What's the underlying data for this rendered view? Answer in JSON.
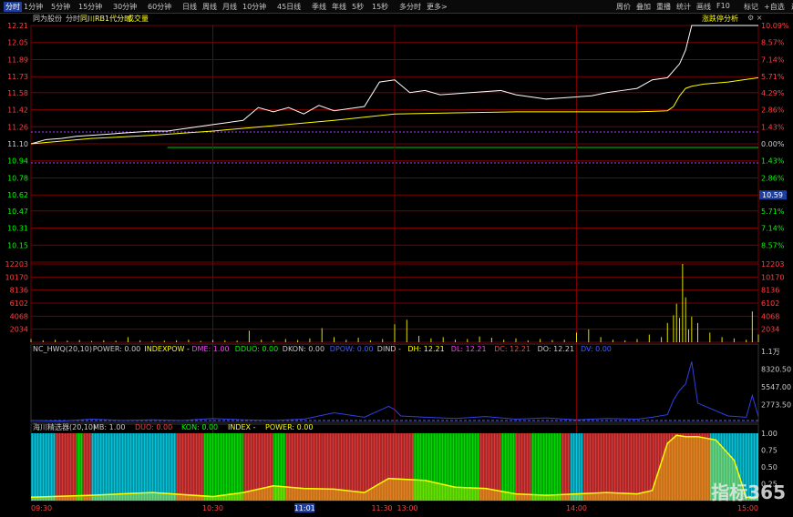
{
  "toolbar": {
    "periods": [
      "分时",
      "1分钟",
      "5分钟",
      "15分钟",
      "30分钟",
      "60分钟",
      "日线",
      "周线",
      "月线",
      "10分钟",
      "45日线",
      "季线",
      "年线",
      "5秒",
      "15秒",
      "多分时",
      "更多>"
    ],
    "right": [
      "周价",
      "叠加",
      "重播",
      "统计",
      "画线",
      "F10",
      "标记",
      "+自选",
      "返回"
    ]
  },
  "info": {
    "label1": "同为股份",
    "label2": "分时",
    "label3": "同川RB1代分时",
    "label4": "成交量",
    "right_label": "涨跌停分析"
  },
  "main_axis": {
    "left": [
      "12.21",
      "12.05",
      "11.89",
      "11.73",
      "11.58",
      "11.42",
      "11.26",
      "11.10",
      "10.94",
      "10.78",
      "10.62",
      "10.47",
      "10.31",
      "10.15"
    ],
    "right": [
      "10.09%",
      "8.57%",
      "7.14%",
      "5.71%",
      "4.29%",
      "2.86%",
      "1.43%",
      "0.00%",
      "1.43%",
      "2.86%",
      "4.29%",
      "5.71%",
      "7.14%",
      "8.57%"
    ],
    "current_price": "10.59"
  },
  "volume_axis": {
    "labels": [
      "12203",
      "10170",
      "8136",
      "6102",
      "4068",
      "2034"
    ]
  },
  "ind1": {
    "name": "NC_HWQ(20,10)",
    "power": "POWER: 0.00",
    "indexpow": "INDEXPOW -",
    "dme": "DME: 1.00",
    "dduo": "DDUO: 0.00",
    "dkon": "DKON: 0.00",
    "dpow": "DPOW: 0.00",
    "dind": "DIND -",
    "dh": "DH: 12.21",
    "dl": "DL: 12.21",
    "dc": "DC: 12.21",
    "do": "DO: 12.21",
    "dv": "DV: 0.00",
    "axis": [
      "1.1万",
      "8320.50",
      "5547.00",
      "2773.50"
    ]
  },
  "ind2": {
    "name": "海川精选器(20,10)",
    "mb": "MB: 1.00",
    "duo": "DUO: 0.00",
    "kon": "KON: 0.00",
    "index": "INDEX -",
    "power": "POWER: 0.00",
    "axis": [
      "1.00",
      "0.75",
      "0.50",
      "0.25"
    ]
  },
  "time_axis": [
    "09:30",
    "10:30",
    "11:30",
    "13:00",
    "14:00",
    "15:00"
  ],
  "cursor_time": "11:01",
  "watermark": "指标365",
  "colors": {
    "price": "#ffffff",
    "avg": "#ffff00",
    "grid": "#8b0000",
    "up": "#ff4040",
    "down": "#00ff00",
    "cyan": "#00e5ff"
  },
  "chart_data": [
    {
      "type": "line",
      "title": "",
      "ylim": [
        9.99,
        12.21
      ],
      "prev_close": 11.1,
      "x_range": [
        0,
        240
      ],
      "series": [
        {
          "x": [
            0,
            5,
            10,
            15,
            20,
            25,
            30,
            35,
            40,
            45,
            50,
            55,
            60,
            65,
            70,
            75,
            80,
            85,
            90,
            95,
            100,
            105,
            110,
            115,
            120,
            125,
            130,
            135,
            140,
            145,
            150,
            155,
            160,
            165,
            170,
            175,
            180,
            185,
            190,
            195,
            200,
            205,
            210,
            214,
            216,
            218,
            222,
            226,
            230,
            235,
            240
          ],
          "values": [
            11.1,
            11.14,
            11.15,
            11.17,
            11.18,
            11.19,
            11.2,
            11.21,
            11.22,
            11.22,
            11.24,
            11.26,
            11.28,
            11.3,
            11.32,
            11.44,
            11.4,
            11.44,
            11.38,
            11.46,
            11.41,
            11.43,
            11.45,
            11.68,
            11.7,
            11.58,
            11.6,
            11.56,
            11.57,
            11.58,
            11.59,
            11.6,
            11.56,
            11.54,
            11.52,
            11.53,
            11.54,
            11.55,
            11.58,
            11.6,
            11.62,
            11.7,
            11.72,
            11.85,
            11.98,
            12.21,
            12.21,
            12.21,
            12.21,
            12.21,
            12.21
          ]
        },
        {
          "x": [
            0,
            20,
            40,
            60,
            80,
            100,
            120,
            140,
            160,
            180,
            200,
            210,
            212,
            214,
            216,
            218,
            222,
            230,
            240
          ],
          "values": [
            11.1,
            11.15,
            11.18,
            11.22,
            11.27,
            11.32,
            11.38,
            11.39,
            11.4,
            11.4,
            11.4,
            11.41,
            11.45,
            11.55,
            11.62,
            11.64,
            11.66,
            11.68,
            11.72
          ]
        }
      ]
    },
    {
      "type": "bar",
      "title": "",
      "ylim": [
        0,
        12203
      ],
      "x": [
        0,
        4,
        8,
        12,
        16,
        20,
        24,
        28,
        32,
        36,
        40,
        44,
        48,
        52,
        56,
        60,
        64,
        68,
        72,
        76,
        80,
        84,
        88,
        92,
        96,
        100,
        104,
        108,
        112,
        116,
        120,
        124,
        128,
        132,
        136,
        140,
        144,
        148,
        152,
        156,
        160,
        164,
        168,
        172,
        176,
        180,
        184,
        188,
        192,
        196,
        200,
        204,
        208,
        210,
        212,
        213,
        214,
        215,
        216,
        217,
        218,
        220,
        224,
        228,
        232,
        236,
        238,
        240
      ],
      "values": [
        500,
        300,
        400,
        250,
        350,
        200,
        300,
        250,
        800,
        300,
        200,
        250,
        300,
        400,
        200,
        350,
        300,
        250,
        1800,
        400,
        300,
        500,
        350,
        600,
        2200,
        800,
        400,
        700,
        300,
        500,
        2800,
        3500,
        1000,
        600,
        800,
        400,
        500,
        900,
        700,
        400,
        600,
        300,
        500,
        350,
        400,
        1500,
        2000,
        800,
        400,
        300,
        500,
        1200,
        800,
        3000,
        4200,
        6000,
        3800,
        12203,
        7000,
        2000,
        4000,
        3000,
        1500,
        800,
        600,
        400,
        4800,
        1200
      ]
    },
    {
      "type": "line",
      "title": "",
      "ylim": [
        0,
        11094
      ],
      "series": [
        {
          "x": [
            0,
            10,
            20,
            30,
            40,
            50,
            60,
            70,
            80,
            90,
            100,
            110,
            118,
            120,
            122,
            130,
            140,
            150,
            160,
            170,
            180,
            190,
            200,
            205,
            210,
            212,
            214,
            216,
            218,
            220,
            230,
            236,
            238,
            240
          ],
          "values": [
            300,
            200,
            500,
            300,
            400,
            300,
            600,
            400,
            300,
            500,
            1500,
            800,
            2500,
            2000,
            1000,
            800,
            600,
            900,
            500,
            700,
            400,
            600,
            500,
            800,
            1200,
            3500,
            5000,
            6000,
            9500,
            3000,
            1000,
            800,
            4200,
            900
          ]
        }
      ]
    },
    {
      "type": "area",
      "title": "",
      "ylim": [
        0,
        1.0
      ],
      "series": [
        {
          "x": [
            0,
            20,
            40,
            60,
            70,
            80,
            90,
            100,
            110,
            118,
            122,
            130,
            140,
            150,
            160,
            170,
            180,
            190,
            200,
            205,
            210,
            213,
            216,
            220,
            226,
            232,
            236,
            240
          ],
          "values": [
            0.05,
            0.08,
            0.12,
            0.06,
            0.12,
            0.22,
            0.18,
            0.17,
            0.12,
            0.33,
            0.32,
            0.3,
            0.2,
            0.18,
            0.1,
            0.08,
            0.1,
            0.12,
            0.1,
            0.15,
            0.85,
            0.97,
            0.95,
            0.95,
            0.9,
            0.6,
            0.05,
            0.05
          ]
        }
      ]
    }
  ]
}
